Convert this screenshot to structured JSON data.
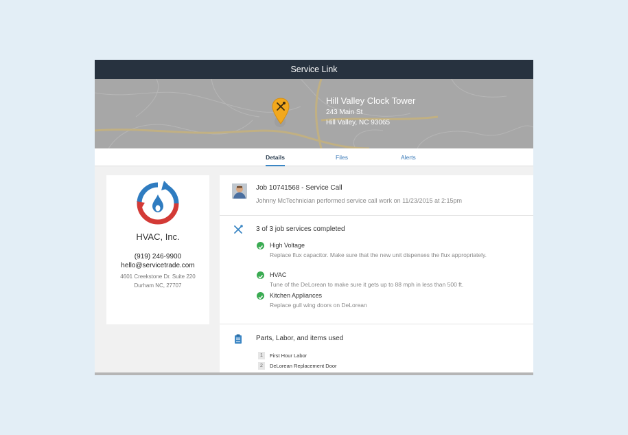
{
  "app": {
    "title": "Service Link"
  },
  "location": {
    "name": "Hill Valley Clock Tower",
    "street": "243 Main St",
    "city": "Hill Valley, NC 93065"
  },
  "tabs": [
    {
      "label": "Details",
      "active": true
    },
    {
      "label": "Files",
      "active": false
    },
    {
      "label": "Alerts",
      "active": false
    }
  ],
  "company": {
    "name": "HVAC, Inc.",
    "phone": "(919) 246-9900",
    "email": "hello@servicetrade.com",
    "address1": "4601 Creekstone Dr. Suite 220",
    "address2": "Durham NC, 27707"
  },
  "job": {
    "title": "Job 10741568 - Service Call",
    "summary": "Johnny McTechnician performed service call work on 11/23/2015 at 2:15pm"
  },
  "services": {
    "header": "3 of 3 job services completed",
    "items": [
      {
        "name": "High Voltage",
        "description": "Replace flux capacitor. Make sure that the new unit dispenses the flux appropriately."
      },
      {
        "name": "HVAC",
        "description": "Tune of the DeLorean to make sure it gets up to 88 mph in less than 500 ft."
      },
      {
        "name": "Kitchen Appliances",
        "description": "Replace gull wing doors on DeLorean"
      }
    ]
  },
  "parts": {
    "header": "Parts, Labor, and items used",
    "items": [
      {
        "num": "1",
        "name": "First Hour Labor"
      },
      {
        "num": "2",
        "name": "DeLorean Replacement Door"
      }
    ]
  },
  "colors": {
    "titlebar": "#27323f",
    "accent": "#3b86c4",
    "check": "#3aab52",
    "pin": "#f2a81d",
    "logo_blue": "#2f7cc0",
    "logo_red": "#d33a36"
  },
  "icons": {
    "pin": "map-pin-tools-icon",
    "services": "tools-icon",
    "parts": "clipboard-icon",
    "check": "checkmark-icon"
  }
}
